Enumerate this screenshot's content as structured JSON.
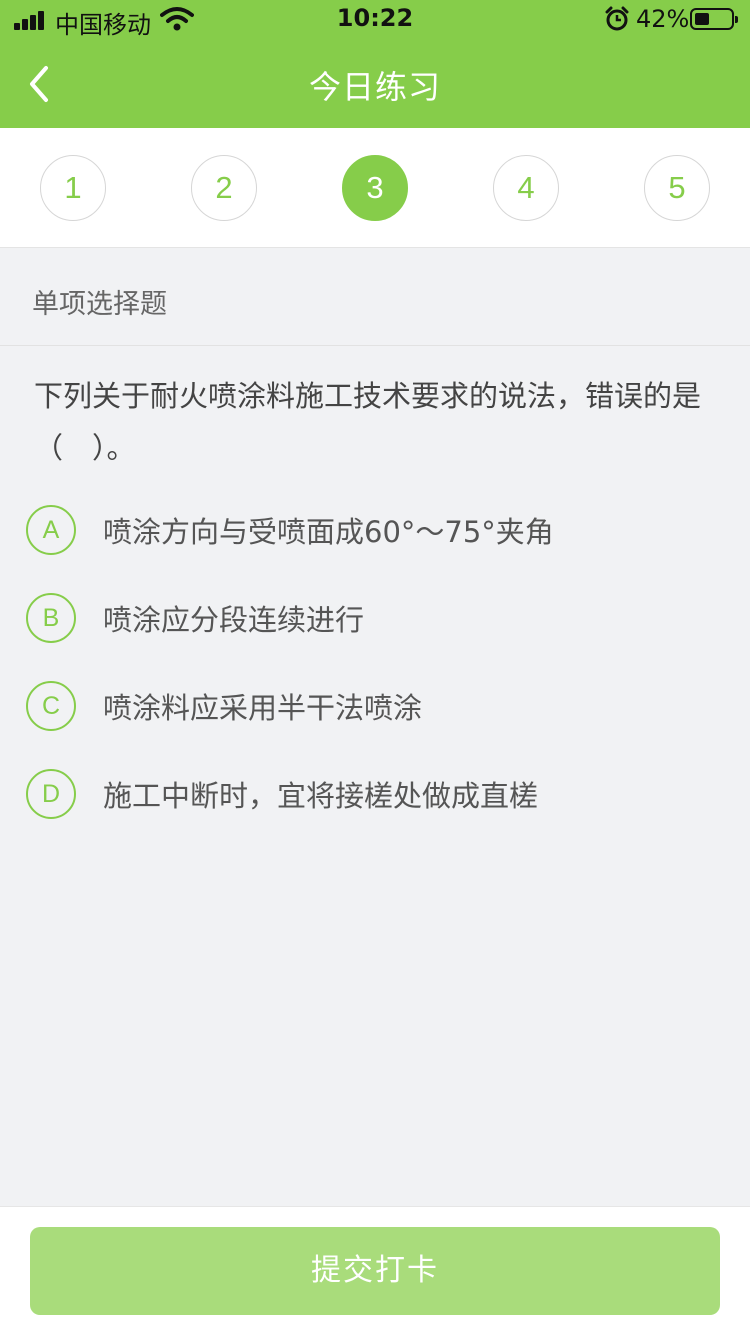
{
  "status_bar": {
    "carrier": "中国移动",
    "time": "10:22",
    "battery_percent": "42%",
    "battery_level": 0.42,
    "icons": [
      "signal-icon",
      "wifi-icon",
      "alarm-icon",
      "battery-icon"
    ]
  },
  "header": {
    "title": "今日练习",
    "back_icon": "chevron-left-icon",
    "background": "#86cd4a"
  },
  "steps": {
    "items": [
      "1",
      "2",
      "3",
      "4",
      "5"
    ],
    "active_index": 2
  },
  "question": {
    "type_label": "单项选择题",
    "text": "下列关于耐火喷涂料施工技术要求的说法，错误的是（　）。",
    "options": [
      {
        "letter": "A",
        "text": "喷涂方向与受喷面成60°～75°夹角"
      },
      {
        "letter": "B",
        "text": "喷涂应分段连续进行"
      },
      {
        "letter": "C",
        "text": "喷涂料应采用半干法喷涂"
      },
      {
        "letter": "D",
        "text": "施工中断时，宜将接槎处做成直槎"
      }
    ]
  },
  "footer": {
    "submit_label": "提交打卡"
  },
  "colors": {
    "accent": "#86cd4a",
    "submit_disabled": "#a9dc7b",
    "background": "#f1f2f4"
  }
}
